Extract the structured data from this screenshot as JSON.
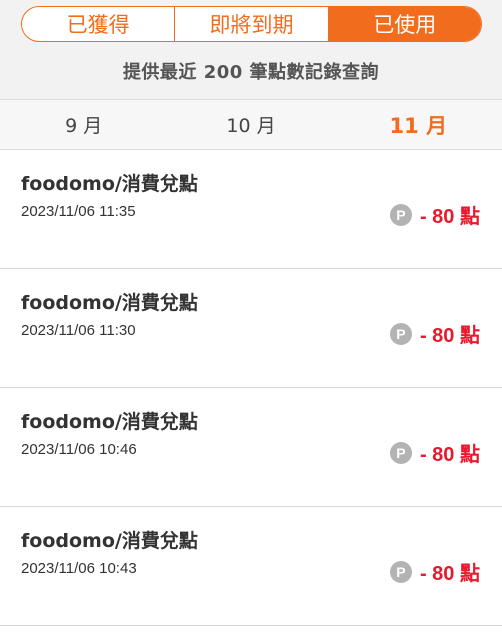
{
  "tabs": [
    {
      "label": "已獲得",
      "active": false
    },
    {
      "label": "即將到期",
      "active": false
    },
    {
      "label": "已使用",
      "active": true
    }
  ],
  "notice": "提供最近 200 筆點數記錄查詢",
  "months": [
    {
      "label": "9 月",
      "active": false
    },
    {
      "label": "10 月",
      "active": false
    },
    {
      "label": "11 月",
      "active": true
    }
  ],
  "records": [
    {
      "title": "foodomo/消費兌點",
      "time": "2023/11/06 11:35",
      "amount": "- 80 點"
    },
    {
      "title": "foodomo/消費兌點",
      "time": "2023/11/06 11:30",
      "amount": "- 80 點"
    },
    {
      "title": "foodomo/消費兌點",
      "time": "2023/11/06 10:46",
      "amount": "- 80 點"
    },
    {
      "title": "foodomo/消費兌點",
      "time": "2023/11/06 10:43",
      "amount": "- 80 點"
    }
  ],
  "icons": {
    "points": "points-coin-icon",
    "points_glyph": "P"
  },
  "colors": {
    "accent": "#f26c1d",
    "deduct": "#e8192c",
    "coin": "#b3b3b3"
  }
}
